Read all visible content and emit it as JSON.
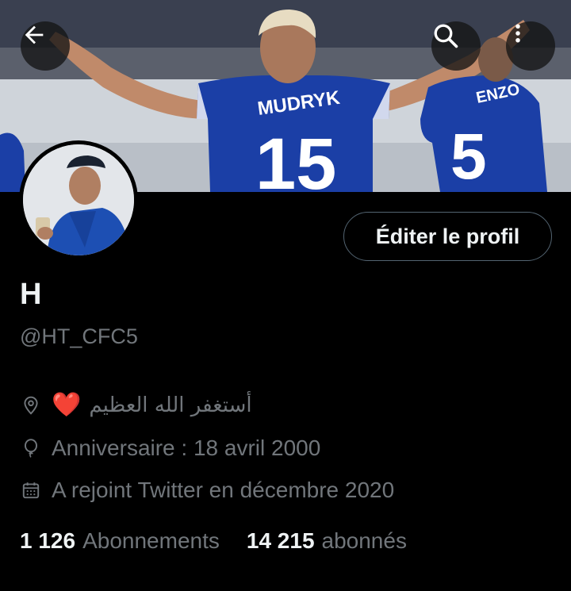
{
  "header": {
    "back_icon": "arrow-left-icon",
    "search_icon": "search-icon",
    "more_icon": "more-vertical-icon"
  },
  "banner": {
    "jersey_name": "MUDRYK",
    "jersey_number": "15",
    "second_player_name": "ENZO",
    "second_player_number": "5"
  },
  "profile": {
    "edit_button": "Éditer le profil",
    "display_name": "H",
    "handle": "@HT_CFC5",
    "location_heart": "❤️",
    "location_text": "أستغفر الله العظيم",
    "birthday": "Anniversaire : 18 avril 2000",
    "joined": "A rejoint Twitter en décembre 2020"
  },
  "stats": {
    "following_count": "1 126",
    "following_label": "Abonnements",
    "followers_count": "14 215",
    "followers_label": "abonnés"
  },
  "colors": {
    "background": "#000000",
    "text_primary": "#eff3f4",
    "text_secondary": "#71767b",
    "border": "#536471",
    "heart": "#e0245e",
    "jersey_blue": "#1b3fa6"
  }
}
